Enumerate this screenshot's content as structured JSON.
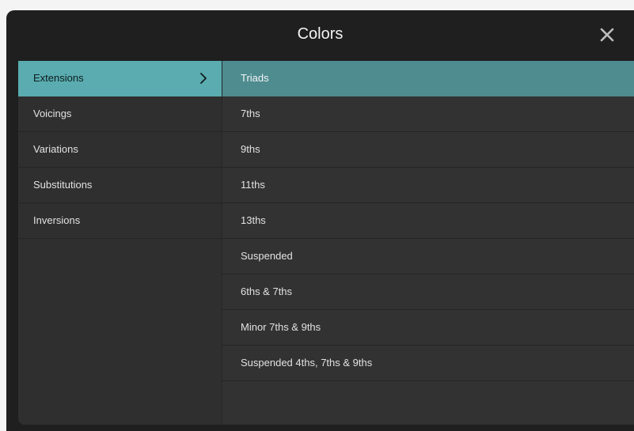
{
  "dialog": {
    "title": "Colors",
    "close_icon": "close-icon"
  },
  "categories": [
    {
      "label": "Extensions",
      "selected": true
    },
    {
      "label": "Voicings",
      "selected": false
    },
    {
      "label": "Variations",
      "selected": false
    },
    {
      "label": "Substitutions",
      "selected": false
    },
    {
      "label": "Inversions",
      "selected": false
    }
  ],
  "options": [
    {
      "label": "Triads",
      "selected": true
    },
    {
      "label": "7ths",
      "selected": false
    },
    {
      "label": "9ths",
      "selected": false
    },
    {
      "label": "11ths",
      "selected": false
    },
    {
      "label": "13ths",
      "selected": false
    },
    {
      "label": "Suspended",
      "selected": false
    },
    {
      "label": "6ths & 7ths",
      "selected": false
    },
    {
      "label": "Minor 7ths & 9ths",
      "selected": false
    },
    {
      "label": "Suspended 4ths, 7ths & 9ths",
      "selected": false
    }
  ],
  "colors": {
    "category_selected": "#5aacb0",
    "option_selected": "#4e8c90",
    "background": "#1f1f1f",
    "panel": "#2f2f2f"
  },
  "icons": {
    "selected_category": "chevron-right-icon"
  }
}
